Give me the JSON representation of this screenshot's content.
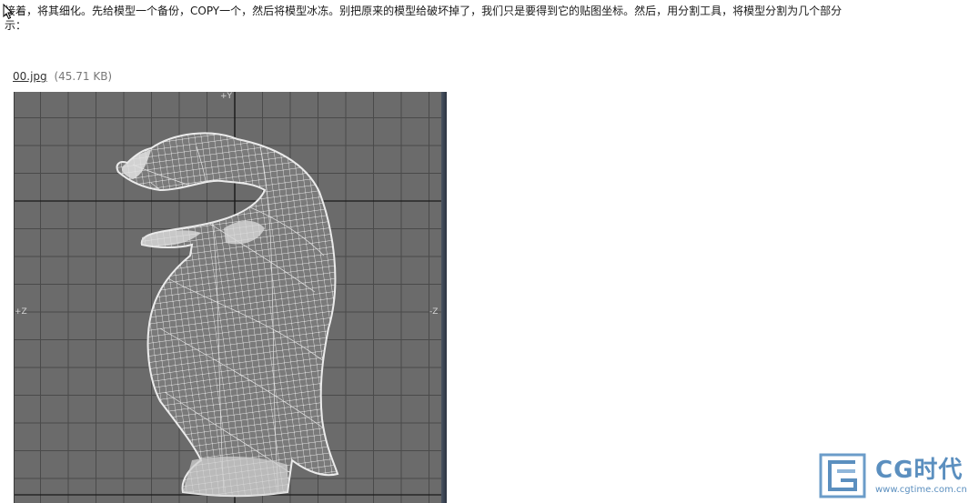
{
  "article": {
    "line1": "接着，将其细化。先给模型一个备份，COPY一个，然后将模型冰冻。别把原来的模型给破坏掉了，我们只是要得到它的贴图坐标。然后，用分割工具，将模型分割为几个部分",
    "line2": "示："
  },
  "attachment": {
    "filename": "00.jpg",
    "size": "(45.71 KB)"
  },
  "viewport": {
    "label_top": "+Y",
    "label_left": "+Z",
    "label_right": "-Z",
    "grid_color": "#4a4a4a",
    "axis_color": "#111111",
    "mesh_color": "#e8e8e8",
    "background": "#6b6b6b"
  },
  "watermark": {
    "title": "CG时代",
    "url": "www.cgtime.com.cn",
    "color": "#5b8fbf"
  }
}
